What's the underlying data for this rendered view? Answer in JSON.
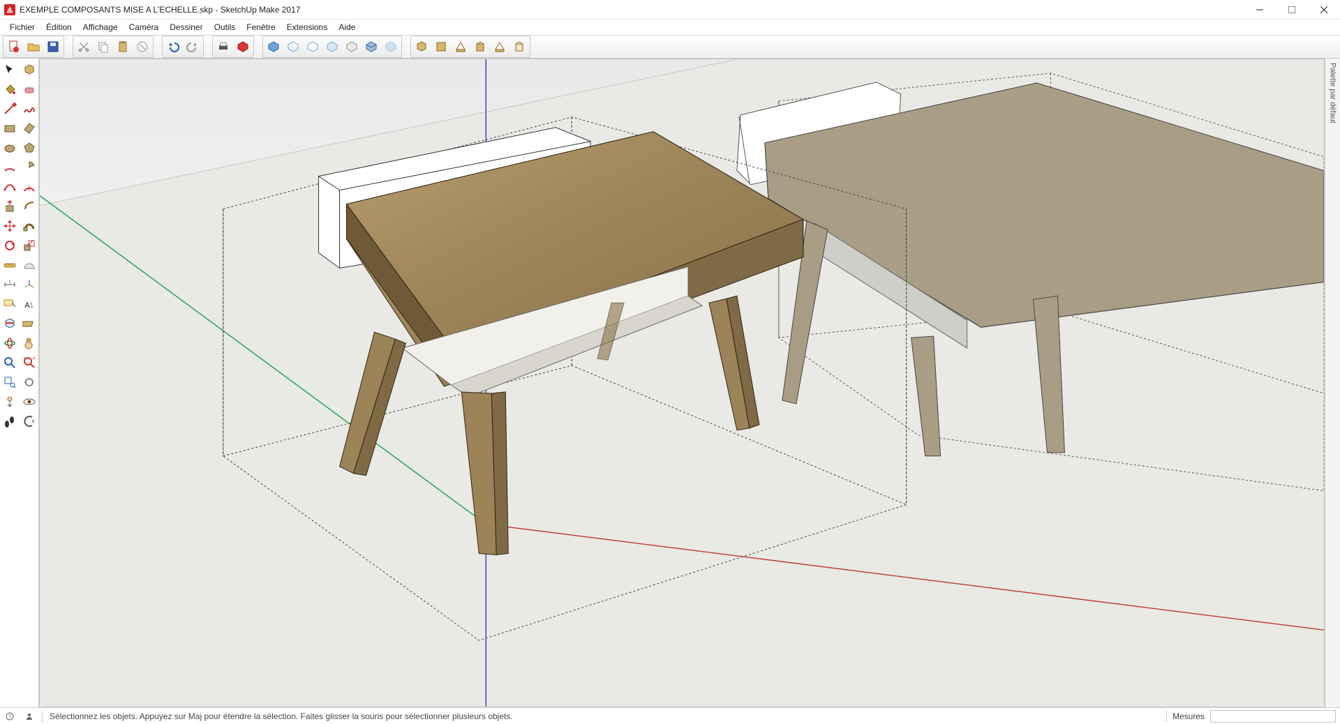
{
  "window": {
    "title": "EXEMPLE COMPOSANTS MISE A L'ECHELLE.skp - SketchUp Make 2017"
  },
  "menu": {
    "items": [
      "Fichier",
      "Édition",
      "Affichage",
      "Caméra",
      "Dessiner",
      "Outils",
      "Fenêtre",
      "Extensions",
      "Aide"
    ]
  },
  "right_tray": {
    "label": "Palette par défaut"
  },
  "status": {
    "hint": "Sélectionnez les objets. Appuyez sur Maj pour étendre la sélection. Faites glisser la souris pour sélectionner plusieurs objets.",
    "measure_label": "Mesures",
    "measure_value": ""
  },
  "toolbar": {
    "group_file": [
      "new",
      "open",
      "save"
    ],
    "group_edit": [
      "cut",
      "copy",
      "paste",
      "delete"
    ],
    "group_undo": [
      "undo",
      "redo"
    ],
    "group_print": [
      "print",
      "model-3d"
    ],
    "group_styles": [
      "style-shaded",
      "style-wire",
      "style-hidden",
      "style-mono",
      "style-white",
      "style-tex",
      "style-xray"
    ],
    "group_views": [
      "iso",
      "top",
      "front",
      "right",
      "back",
      "left"
    ]
  },
  "left_tools": [
    [
      "select",
      "component"
    ],
    [
      "paint",
      "eraser"
    ],
    [
      "line",
      "freehand"
    ],
    [
      "rectangle",
      "rect-rot"
    ],
    [
      "circle",
      "polygon"
    ],
    [
      "arc",
      "pie"
    ],
    [
      "arc3",
      "arc-center"
    ],
    [
      "pushpull",
      "offset"
    ],
    [
      "move",
      "follow"
    ],
    [
      "rotate",
      "scale"
    ],
    [
      "tape",
      "protractor"
    ],
    [
      "dimension",
      "axes"
    ],
    [
      "text",
      "3dtext"
    ],
    [
      "section",
      "plane"
    ],
    [
      "orbit",
      "pan"
    ],
    [
      "zoom",
      "zoom-extents"
    ],
    [
      "zoom-window",
      "prev-view"
    ],
    [
      "walk",
      "look"
    ],
    [
      "position",
      "eye"
    ]
  ],
  "colors": {
    "wood": "#9c8358",
    "wood_dark": "#7f6a46",
    "taupe": "#a99d85",
    "white": "#ffffff",
    "grey_panel": "#c7c7bd",
    "axis_r": "#c0392b",
    "axis_g": "#27ae60",
    "axis_b": "#2b3fc7",
    "ground": "#e8e8e8"
  }
}
